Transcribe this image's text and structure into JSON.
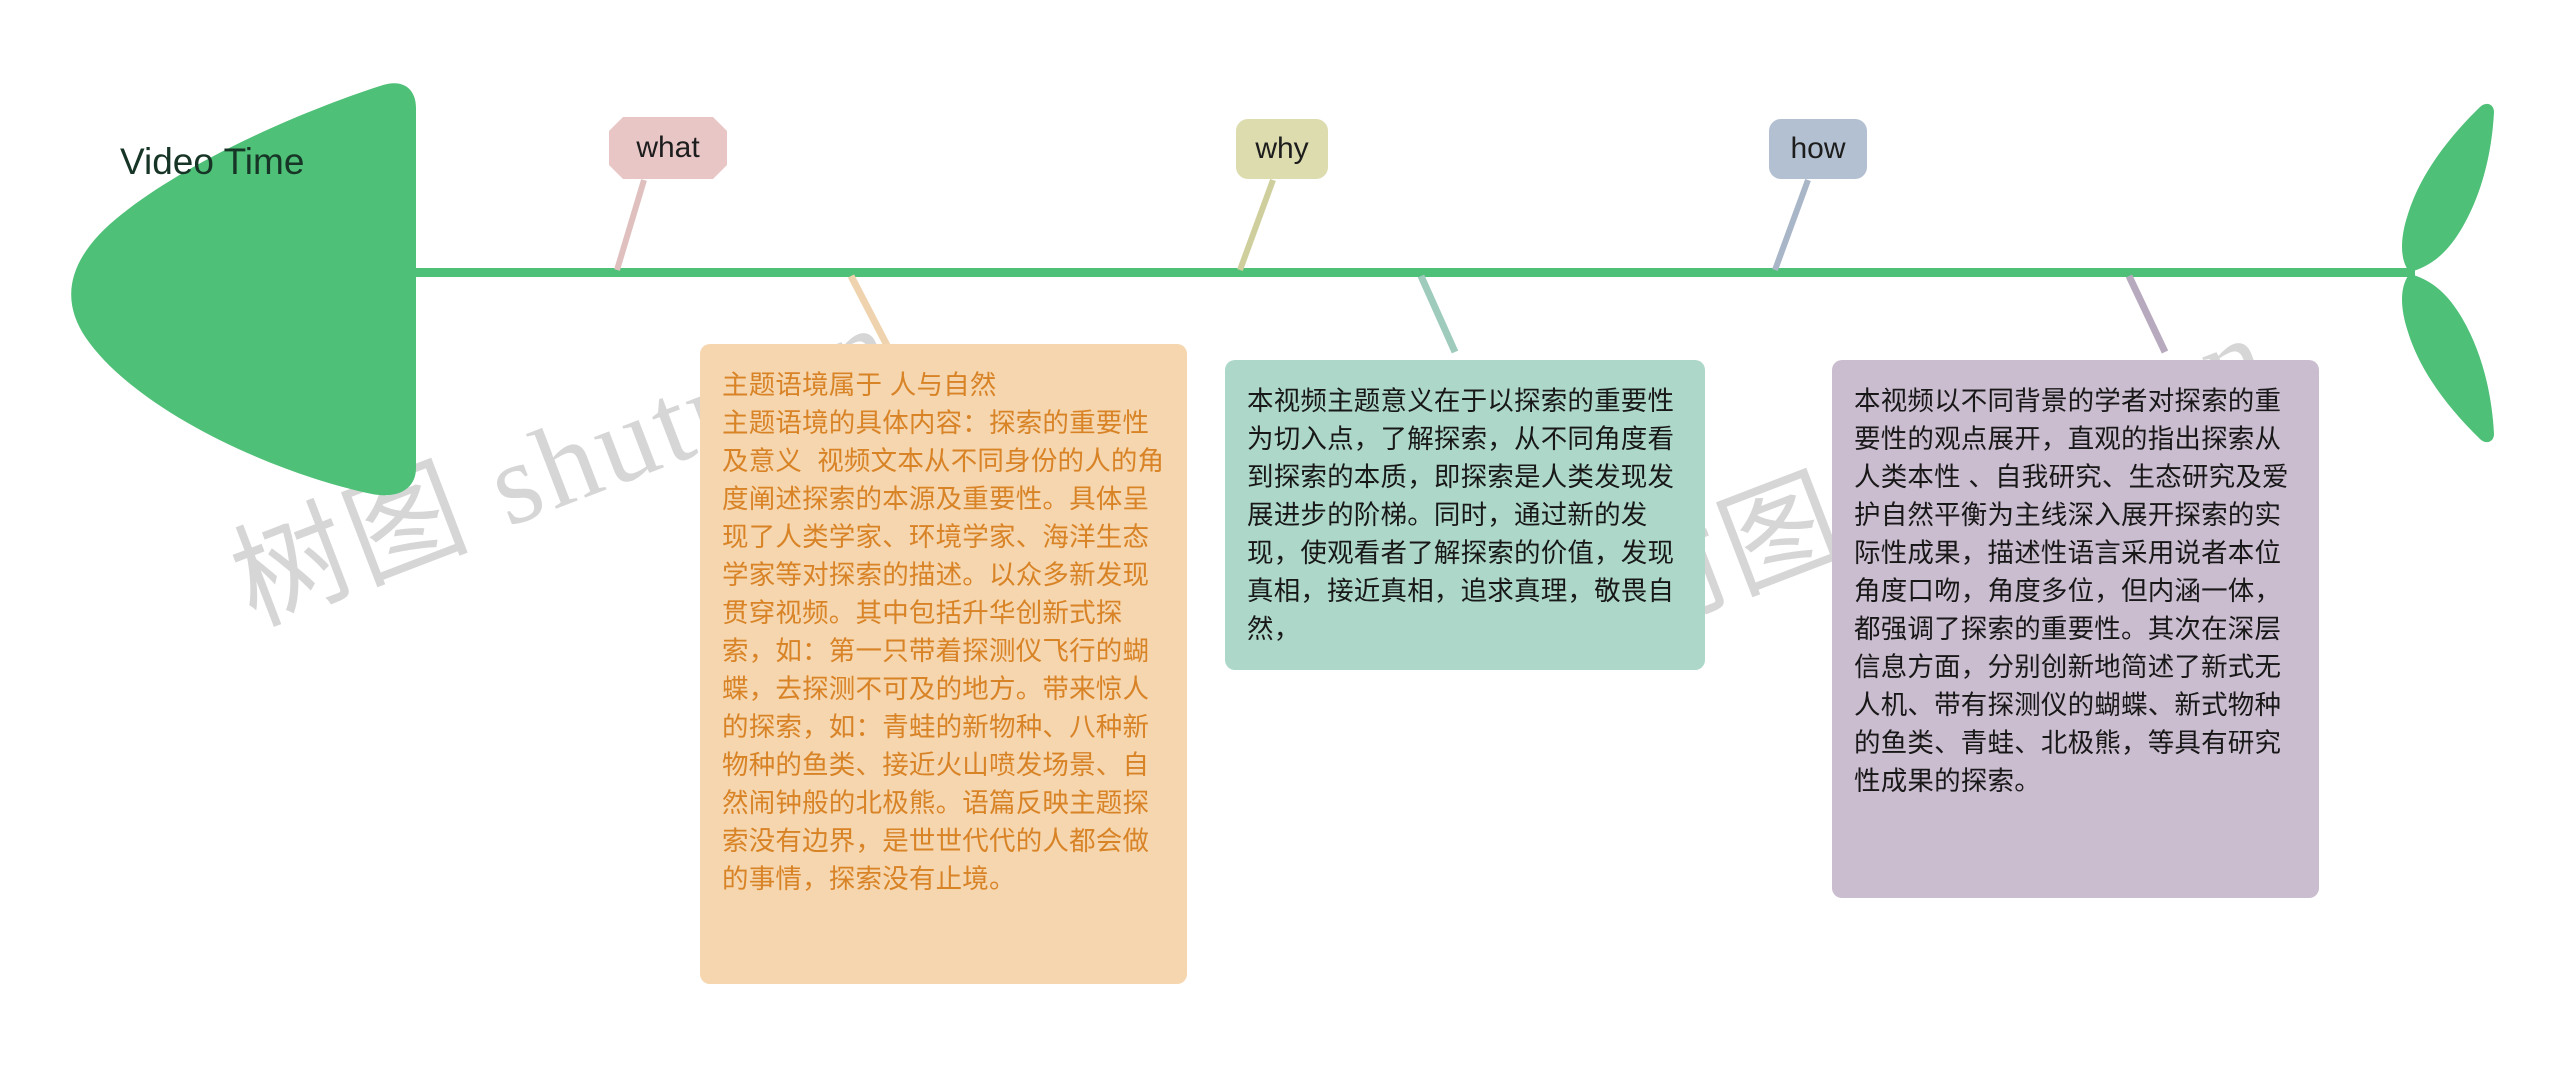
{
  "diagram": {
    "type": "fishbone",
    "head": {
      "title": "Video Time",
      "color": "#4ec077"
    },
    "spine": {
      "color": "#4ec077"
    },
    "tail": {
      "color": "#4ec077"
    },
    "watermarks": [
      {
        "text": "树图 shutu.cn"
      },
      {
        "text": "树图 shutu.cn"
      }
    ],
    "branches": [
      {
        "key": "what",
        "label": "what",
        "label_bg": "#e9c6c6",
        "connector_color": "#e0bfbf",
        "box_bg": "#f5d6ae",
        "box_text_color": "#d98327",
        "content": "主题语境属于 人与自然\n主题语境的具体内容：探索的重要性及意义  视频文本从不同身份的人的角度阐述探索的本源及重要性。具体呈现了人类学家、环境学家、海洋生态学家等对探索的描述。以众多新发现贯穿视频。其中包括升华创新式探索，如：第一只带着探测仪飞行的蝴蝶，去探测不可及的地方。带来惊人的探索，如：青蛙的新物种、八种新物种的鱼类、接近火山喷发场景、自然闹钟般的北极熊。语篇反映主题探索没有边界，是世世代代的人都会做的事情，探索没有止境。"
      },
      {
        "key": "why",
        "label": "why",
        "label_bg": "#dcdcae",
        "connector_color": "#cfcf9e",
        "box_bg": "#add8c9",
        "box_text_color": "#181818",
        "content": "本视频主题意义在于以探索的重要性为切入点，了解探索，从不同角度看到探索的本质，即探索是人类发现发展进步的阶梯。同时，通过新的发现，使观看者了解探索的价值，发现真相，接近真相，追求真理，敬畏自然，"
      },
      {
        "key": "how",
        "label": "how",
        "label_bg": "#b3c0d1",
        "connector_color": "#a9b6c7",
        "box_bg": "#cbbdd0",
        "box_text_color": "#181818",
        "content": "本视频以不同背景的学者对探索的重要性的观点展开，直观的指出探索从人类本性 、自我研究、生态研究及爱护自然平衡为主线深入展开探索的实际性成果，描述性语言采用说者本位角度口吻，角度多位，但内涵一体，都强调了探索的重要性。其次在深层信息方面，分别创新地简述了新式无人机、带有探测仪的蝴蝶、新式物种的鱼类、青蛙、北极熊，等具有研究性成果的探索。"
      }
    ]
  }
}
